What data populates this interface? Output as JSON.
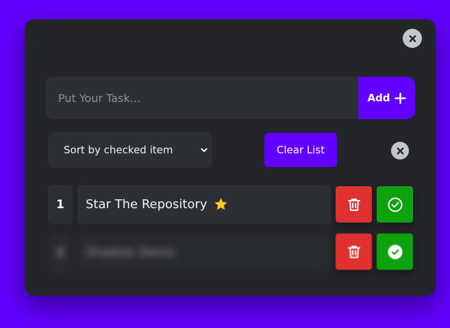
{
  "colors": {
    "background": "#6200ff",
    "card": "#232529",
    "field": "#2c2f33",
    "accent": "#6200ff",
    "delete": "#e03131",
    "check": "#0ea30e",
    "close": "#c3c7cc"
  },
  "input": {
    "placeholder": "Put Your Task...",
    "value": ""
  },
  "add_button": {
    "label": "Add",
    "icon": "plus-icon"
  },
  "sort": {
    "selected": "Sort by checked item",
    "icon": "chevron-down-icon"
  },
  "clear_button": {
    "label": "Clear List"
  },
  "tasks": [
    {
      "number": "1",
      "text": "Star The Repository",
      "emoji_icon": "star-icon",
      "checked": false,
      "blurred": false
    },
    {
      "number": "2",
      "text": "Shadow Demo",
      "checked": true,
      "blurred": true
    }
  ]
}
